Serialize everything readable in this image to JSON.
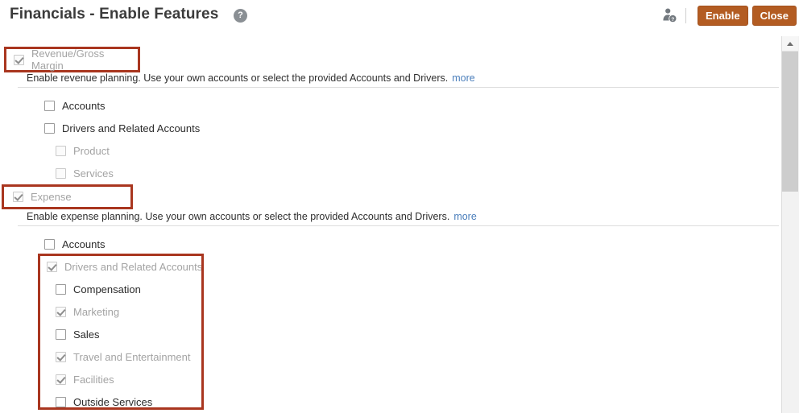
{
  "header": {
    "title": "Financials - Enable Features",
    "help_icon": "question-circle-icon",
    "help_icon_glyph": "?",
    "user_help_icon": "user-help-icon",
    "buttons": [
      {
        "label": "Enable",
        "name": "enable-button"
      },
      {
        "label": "Close",
        "name": "close-button"
      }
    ],
    "accent_color": "#b35c22"
  },
  "highlight_color": "#a9361f",
  "sections": [
    {
      "id": "revenue",
      "label": "Revenue/Gross Margin",
      "checked": true,
      "disabled": true,
      "highlighted": true,
      "description": "Enable revenue planning. Use your own accounts or select the provided Accounts and Drivers.",
      "more_label": "more",
      "items": [
        {
          "label": "Accounts",
          "checked": false,
          "disabled": false,
          "indent": 1
        },
        {
          "label": "Drivers and Related Accounts",
          "checked": false,
          "disabled": false,
          "indent": 1
        },
        {
          "label": "Product",
          "checked": false,
          "disabled": true,
          "indent": 2
        },
        {
          "label": "Services",
          "checked": false,
          "disabled": true,
          "indent": 2
        }
      ]
    },
    {
      "id": "expense",
      "label": "Expense",
      "checked": true,
      "disabled": true,
      "highlighted": true,
      "description": "Enable expense planning. Use your own accounts or select the provided Accounts and Drivers.",
      "more_label": "more",
      "items": [
        {
          "label": "Accounts",
          "checked": false,
          "disabled": false,
          "indent": 1
        },
        {
          "label": "Drivers and Related Accounts",
          "checked": true,
          "disabled": true,
          "indent": 1
        },
        {
          "label": "Compensation",
          "checked": false,
          "disabled": false,
          "indent": 2
        },
        {
          "label": "Marketing",
          "checked": true,
          "disabled": true,
          "indent": 2
        },
        {
          "label": "Sales",
          "checked": false,
          "disabled": false,
          "indent": 2
        },
        {
          "label": "Travel and Entertainment",
          "checked": true,
          "disabled": true,
          "indent": 2
        },
        {
          "label": "Facilities",
          "checked": true,
          "disabled": true,
          "indent": 2
        },
        {
          "label": "Outside Services",
          "checked": false,
          "disabled": false,
          "indent": 2
        }
      ]
    }
  ],
  "scrollbar": {
    "up_arrow_icon": "chevron-up-icon",
    "thumb": "scroll-thumb"
  }
}
